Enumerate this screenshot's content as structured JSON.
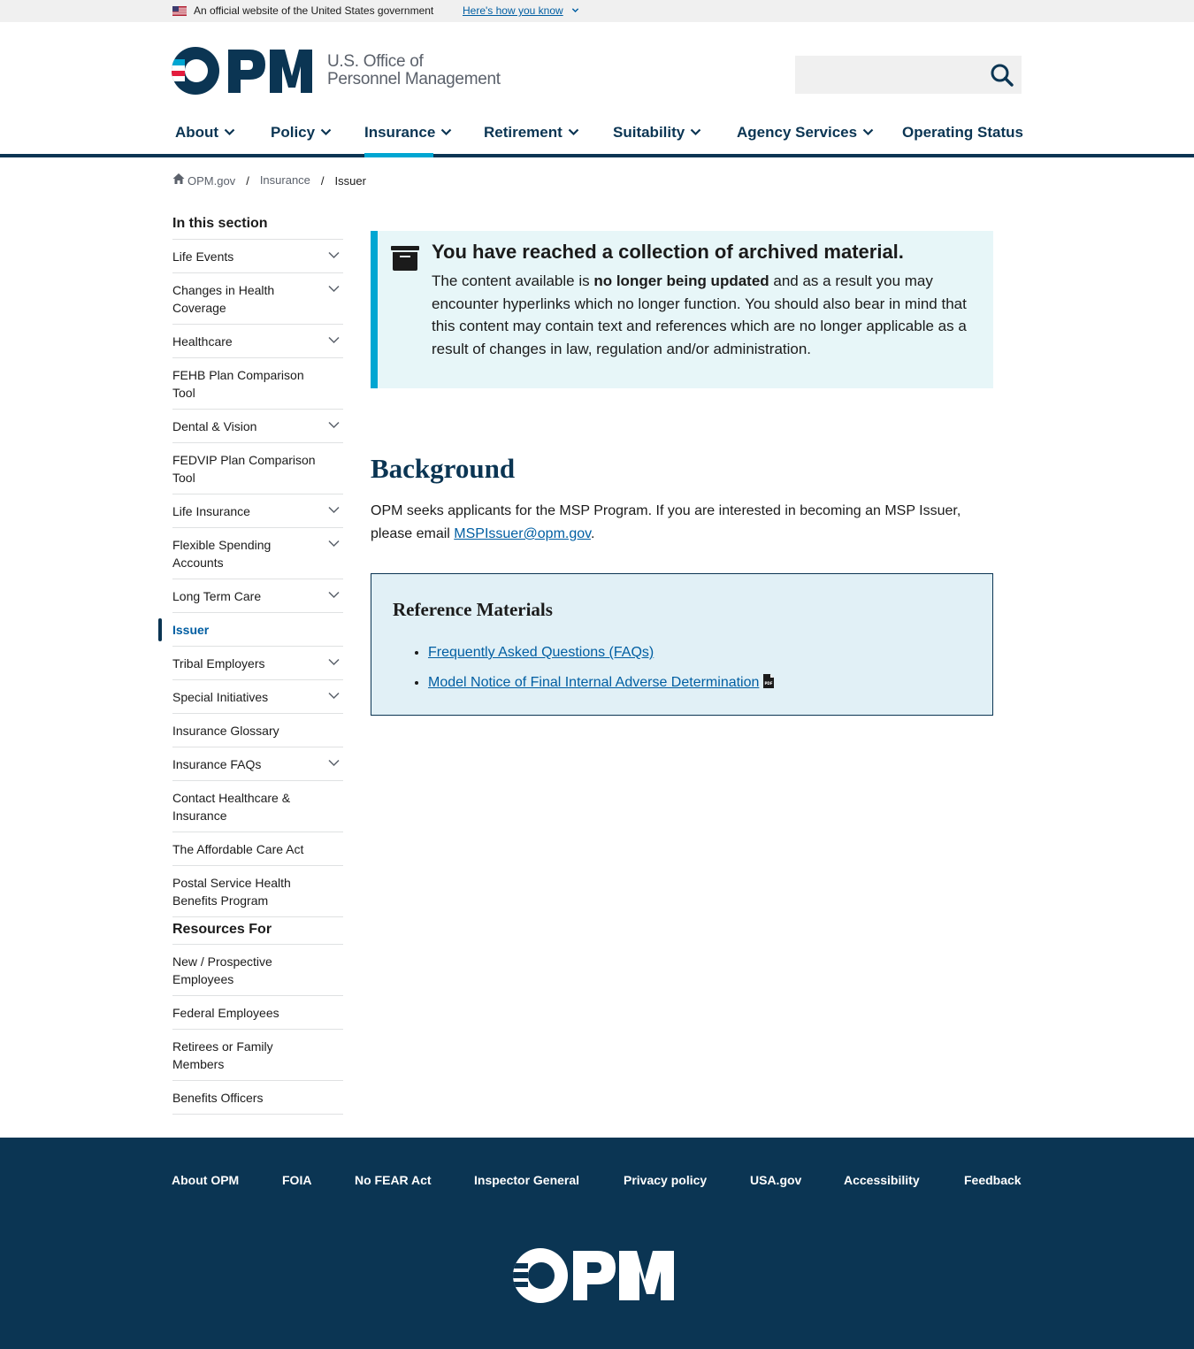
{
  "gov_banner": {
    "official_text": "An official website of the United States government",
    "how_link": "Here's how you know"
  },
  "header": {
    "logo_text": "OPM",
    "logo_line1": "U.S. Office of",
    "logo_line2": "Personnel Management",
    "search_placeholder": ""
  },
  "nav": {
    "items": [
      {
        "label": "About",
        "has_dropdown": true
      },
      {
        "label": "Policy",
        "has_dropdown": true
      },
      {
        "label": "Insurance",
        "has_dropdown": true,
        "active": true
      },
      {
        "label": "Retirement",
        "has_dropdown": true
      },
      {
        "label": "Suitability",
        "has_dropdown": true
      },
      {
        "label": "Agency Services",
        "has_dropdown": true
      },
      {
        "label": "Operating Status",
        "has_dropdown": false
      }
    ]
  },
  "breadcrumb": {
    "home": "OPM.gov",
    "section": "Insurance",
    "current": "Issuer"
  },
  "sidebar": {
    "heading": "In this section",
    "items": [
      {
        "label": "Life Events",
        "expandable": true
      },
      {
        "label": "Changes in Health Coverage",
        "expandable": true
      },
      {
        "label": "Healthcare",
        "expandable": true
      },
      {
        "label": "FEHB Plan Comparison Tool",
        "expandable": false
      },
      {
        "label": "Dental & Vision",
        "expandable": true
      },
      {
        "label": "FEDVIP Plan Comparison Tool",
        "expandable": false
      },
      {
        "label": "Life Insurance",
        "expandable": true
      },
      {
        "label": "Flexible Spending Accounts",
        "expandable": true
      },
      {
        "label": "Long Term Care",
        "expandable": true
      },
      {
        "label": "Issuer",
        "expandable": false,
        "current": true
      },
      {
        "label": "Tribal Employers",
        "expandable": true
      },
      {
        "label": "Special Initiatives",
        "expandable": true
      },
      {
        "label": "Insurance Glossary",
        "expandable": false
      },
      {
        "label": "Insurance FAQs",
        "expandable": true
      },
      {
        "label": "Contact Healthcare & Insurance",
        "expandable": false
      },
      {
        "label": "The Affordable Care Act",
        "expandable": false
      },
      {
        "label": "Postal Service Health Benefits Program",
        "expandable": false
      }
    ],
    "resources_heading": "Resources For",
    "resources": [
      {
        "label": "New / Prospective Employees"
      },
      {
        "label": "Federal Employees"
      },
      {
        "label": "Retirees or Family Members"
      },
      {
        "label": "Benefits Officers"
      }
    ]
  },
  "alert": {
    "title": "You have reached a collection of archived material.",
    "text_before": "The content available is ",
    "text_bold": "no longer being updated",
    "text_after": " and as a result you may encounter hyperlinks which no longer function. You should also bear in mind that this content may contain text and references which are no longer applicable as a result of changes in law, regulation and/or administration."
  },
  "content": {
    "heading": "Background",
    "text_before": "OPM seeks applicants for the MSP Program. If you are interested in becoming an MSP Issuer, please email ",
    "email": "MSPIssuer@opm.gov",
    "text_after": "."
  },
  "references": {
    "heading": "Reference Materials",
    "links": [
      {
        "label": "Frequently Asked Questions (FAQs)",
        "pdf": false
      },
      {
        "label": "Model Notice of Final Internal Adverse Determination",
        "pdf": true
      }
    ]
  },
  "footer": {
    "links": [
      "About OPM",
      "FOIA",
      "No FEAR Act",
      "Inspector General",
      "Privacy policy",
      "USA.gov",
      "Accessibility",
      "Feedback"
    ],
    "logo_text": "OPM"
  },
  "colors": {
    "navy": "#0b3553",
    "cyan_accent": "#00a6d2",
    "link": "#005ea2",
    "alert_bg": "#e7f6f8",
    "ref_bg": "#e1f0f6",
    "opm_red": "#e31c3d"
  }
}
